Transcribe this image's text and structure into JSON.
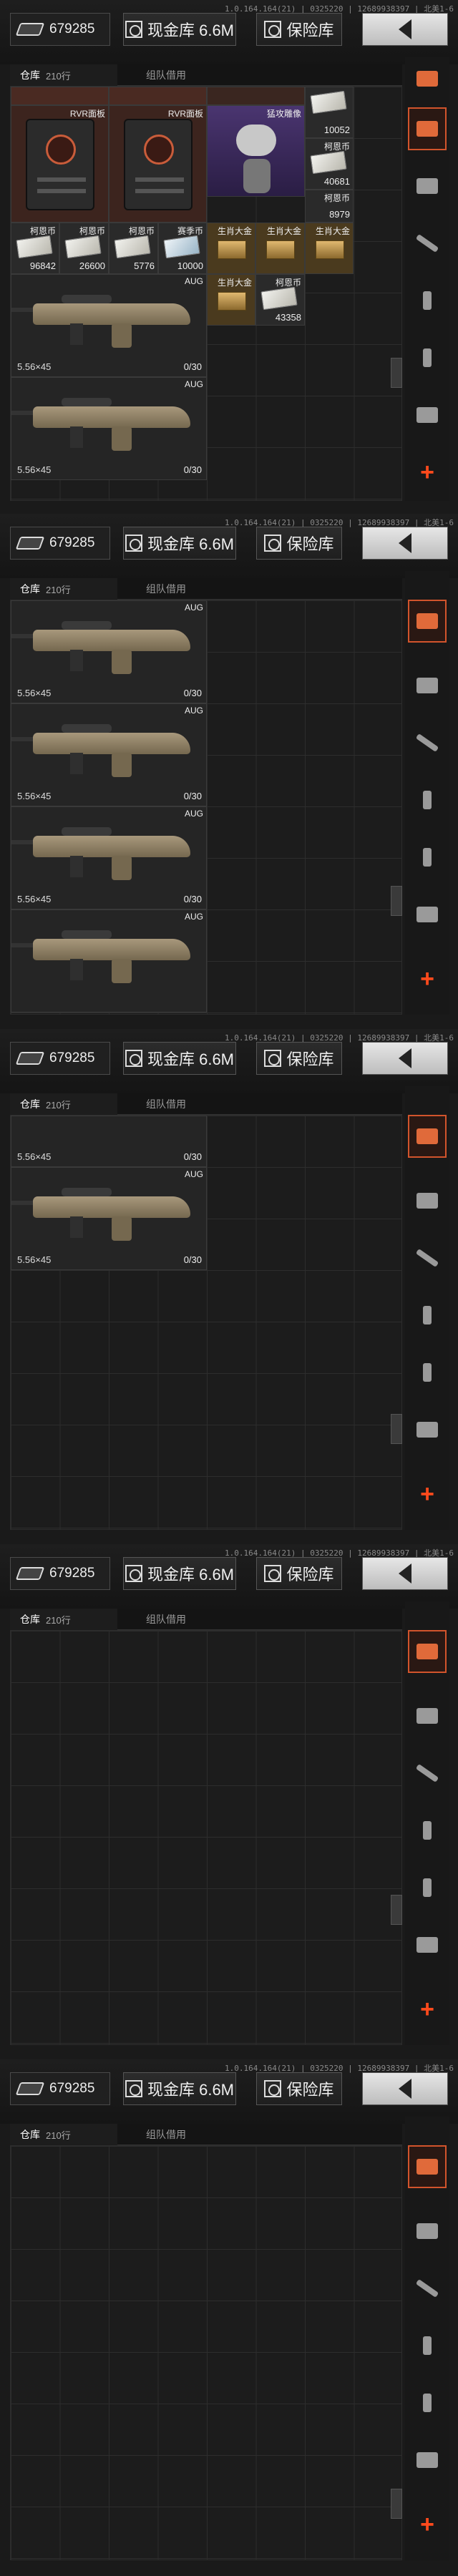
{
  "header": {
    "version": "1.0.164.164(21) | 0325220 | 12689938397 | 北美1-6",
    "money": "679285",
    "cash_button": "现金库 6.6M",
    "safe_button": "保险库"
  },
  "tabs": {
    "warehouse": "仓库",
    "rows": "210行",
    "team": "组队借用"
  },
  "items": {
    "rvr": "RVR面板",
    "statue": "猛攻雕像",
    "coin": "柯恩币",
    "hadhi": "赛季币",
    "gold": "生肖大金",
    "gold2": "生肖大金",
    "aug": "AUG",
    "ammo": "5.56×45",
    "mag": "0/30",
    "q10052": "10052",
    "q40681": "40681",
    "q8979": "8979",
    "q96842": "96842",
    "q26600": "26600",
    "q5776": "5776",
    "q10000": "10000",
    "q43358": "43358"
  },
  "colors": {
    "accent": "#d2542c",
    "plus": "#ff4a1c"
  }
}
